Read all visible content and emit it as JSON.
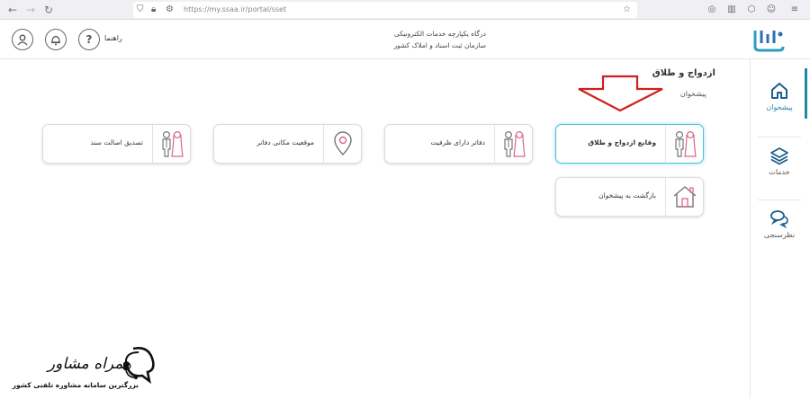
{
  "browser": {
    "url": "https://my.ssaa.ir/portal/sset"
  },
  "header": {
    "help_label": "راهنما",
    "org_line1": "درگاه یکپارچه خدمات الکترونیکی",
    "org_line2": "سازمان ثبت اسناد و املاک کشور"
  },
  "sidebar": {
    "items": [
      {
        "label": "پیشخوان",
        "icon": "home-icon"
      },
      {
        "label": "خدمات",
        "icon": "layers-icon"
      },
      {
        "label": "نظرسنجی",
        "icon": "chat-icon"
      }
    ]
  },
  "main": {
    "title": "ازدواج و طلاق",
    "breadcrumb": "پیشخوان",
    "cards": [
      {
        "label": "وقایع ازدواج و طلاق",
        "icon": "couple-icon",
        "selected": true
      },
      {
        "label": "دفاتر دارای ظرفیت",
        "icon": "couple-icon"
      },
      {
        "label": "موقعیت مکانی دفاتر",
        "icon": "location-pin-icon"
      },
      {
        "label": "تصدیق اصالت سند",
        "icon": "couple-icon"
      },
      {
        "label": "بازگشت به پیشخوان",
        "icon": "home-outline-icon"
      }
    ]
  },
  "watermark": {
    "name": "همراه مشاور",
    "tagline": "بزرگترین سامانه مشاوره تلفنی کشور"
  },
  "colors": {
    "accent": "#1e88a8",
    "card_selected_border": "#4ac4d8",
    "arrow": "#d11f1f",
    "couple_pink": "#d9668e"
  }
}
